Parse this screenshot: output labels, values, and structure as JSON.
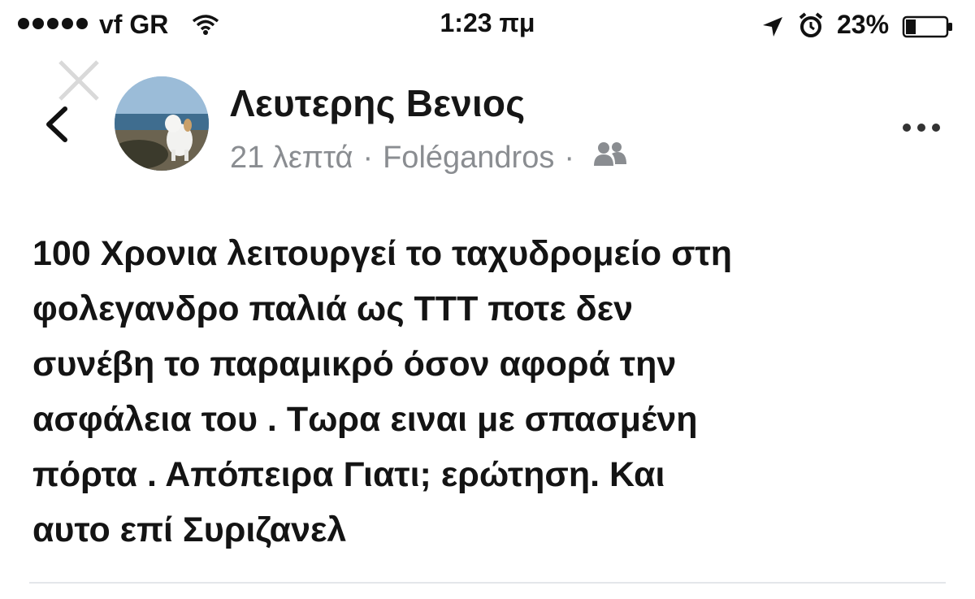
{
  "status_bar": {
    "carrier": "vf GR",
    "time": "1:23 πμ",
    "battery": "23%",
    "icons": [
      "signal-dots-icon",
      "wifi-icon",
      "location-arrow-icon",
      "alarm-icon",
      "battery-icon"
    ]
  },
  "post": {
    "author": "Λευτερης Βενιος",
    "time_ago": "21 λεπτά",
    "separator": "·",
    "location": "Folégandros",
    "audience_icon": "friends-icon",
    "body_lines": [
      "100 Χρονια λειτουργεί το ταχυδρομείο στη",
      "φολεγανδρο παλιά ως ΤΤΤ ποτε δεν",
      "συνέβη το παραμικρό όσον αφορά την",
      "ασφάλεια του . Τωρα ειναι με σπασμένη",
      "πόρτα . Απόπειρα Γιατι; ερώτηση. Και",
      "αυτο επί Συριζανελ"
    ]
  },
  "nav": {
    "back_icon": "chevron-left-icon",
    "close_icon": "close-icon",
    "more_icon": "more-options-icon"
  },
  "colors": {
    "text": "#141414",
    "meta": "#8a8d91",
    "divider": "#e4e6ea"
  }
}
